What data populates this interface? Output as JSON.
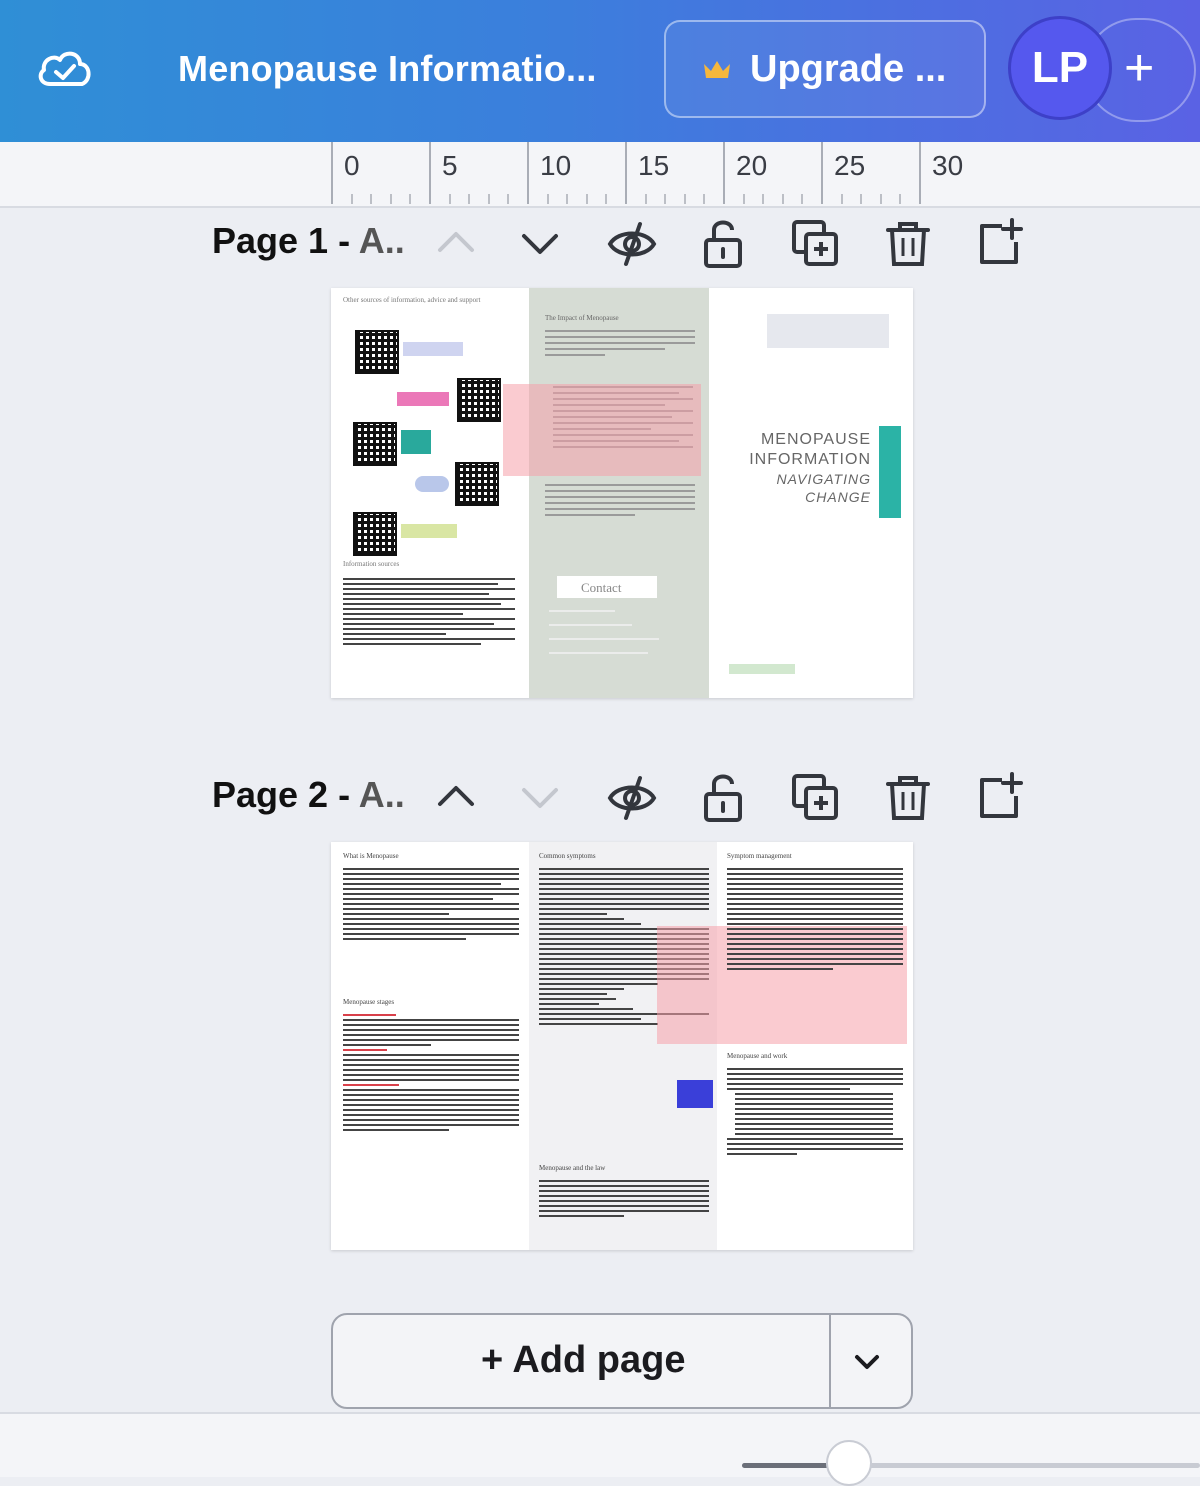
{
  "header": {
    "document_title": "Menopause Informatio...",
    "upgrade_label": "Upgrade ...",
    "avatar_initials": "LP",
    "add_collaborator_label": "+"
  },
  "ruler": {
    "ticks": [
      "0",
      "5",
      "10",
      "15",
      "20",
      "25",
      "30"
    ]
  },
  "pages": [
    {
      "label_bold": "Page 1 -",
      "label_dim": "A..",
      "panel1": {
        "heading": "Other sources of information, advice and support",
        "section": "Information sources"
      },
      "panel2": {
        "heading": "The Impact of Menopause",
        "contact_button": "Contact"
      },
      "panel3": {
        "title_line1": "MENOPAUSE",
        "title_line2": "INFORMATION",
        "subtitle_line1": "NAVIGATING",
        "subtitle_line2": "CHANGE"
      }
    },
    {
      "label_bold": "Page 2 -",
      "label_dim": "A..",
      "col1": {
        "heading": "What is Menopause",
        "subheading": "Menopause stages"
      },
      "col2": {
        "heading": "Common symptoms",
        "subheading": "Menopause and the law"
      },
      "col3": {
        "heading": "Symptom management",
        "subheading": "Menopause and work"
      }
    }
  ],
  "add_page": {
    "label": "+ Add page"
  },
  "colors": {
    "accent_teal": "#2bb3a6",
    "panel_gray": "#d6dcd4",
    "highlight_pink": "#f5a0aa"
  }
}
